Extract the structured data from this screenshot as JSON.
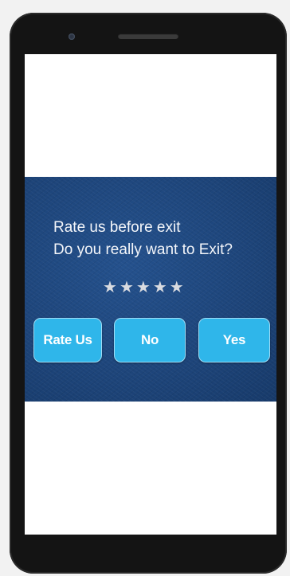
{
  "dialog": {
    "line1": "Rate us before exit",
    "line2": "Do you really want to Exit?",
    "rating": {
      "value": 5,
      "max": 5,
      "glyph": "★"
    },
    "buttons": {
      "rate_us": "Rate Us",
      "no": "No",
      "yes": "Yes"
    }
  },
  "colors": {
    "dialog_background": "#1d4479",
    "button": "#2fb6ea",
    "text": "#f4f6fa",
    "star": "#d9dbe0"
  }
}
